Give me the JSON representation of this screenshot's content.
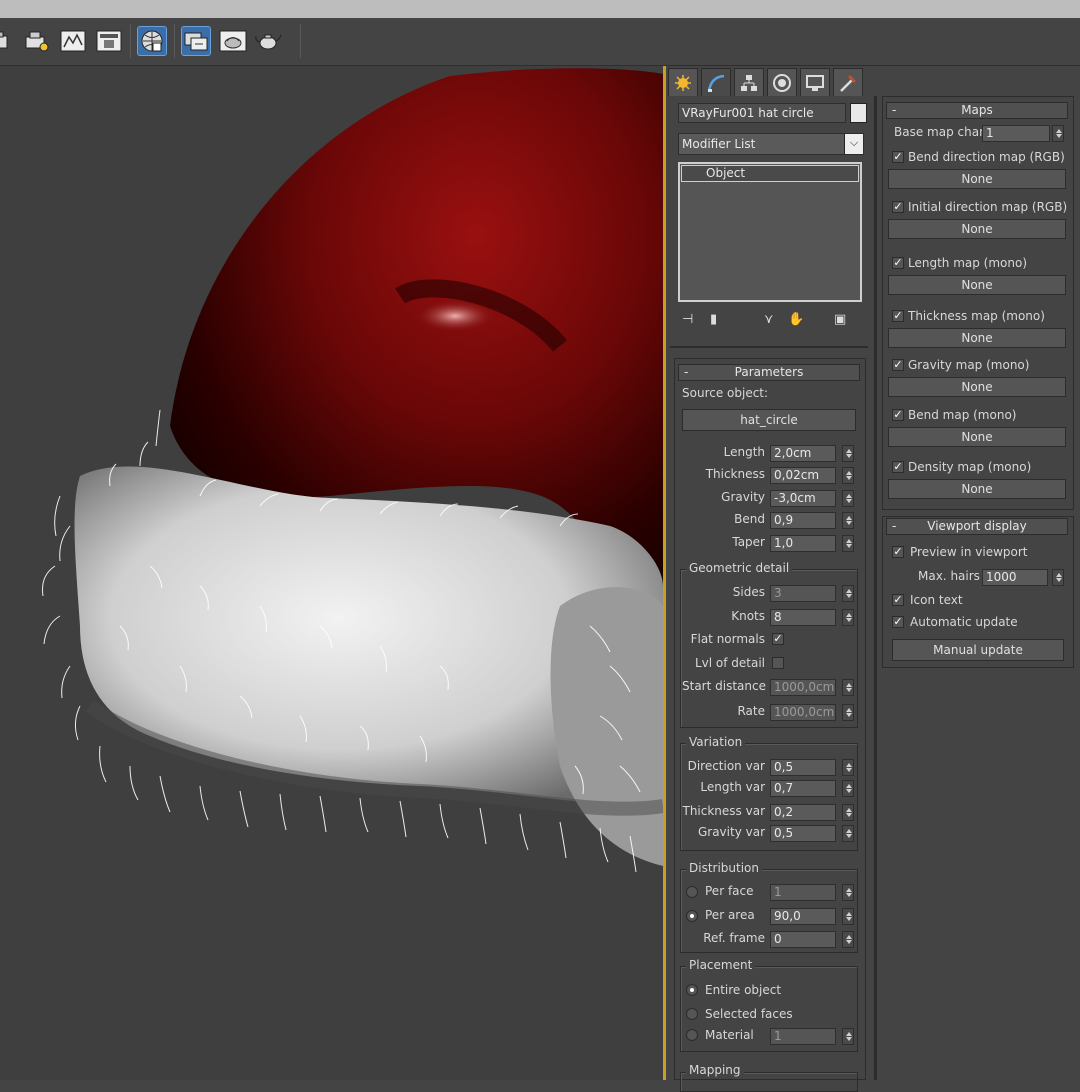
{
  "toolbar": {
    "icons": [
      "render-setup-icon",
      "render-frame-icon",
      "rendered-frame-window-icon",
      "render-to-texture-icon",
      "environment-icon",
      "material-editor-icon",
      "render-production-icon",
      "teapot-render-icon"
    ]
  },
  "command_panel": {
    "tabs": [
      "create-tab",
      "modify-tab",
      "hierarchy-tab",
      "motion-tab",
      "display-tab",
      "utilities-tab"
    ],
    "object_name": "VRayFur001 hat circle",
    "modifier_list": "Modifier List",
    "stack_item": "Object"
  },
  "parameters": {
    "header": "Parameters",
    "source_label": "Source object:",
    "source_button": "hat_circle",
    "length_label": "Length",
    "length": "2,0cm",
    "thickness_label": "Thickness",
    "thickness": "0,02cm",
    "gravity_label": "Gravity",
    "gravity": "-3,0cm",
    "bend_label": "Bend",
    "bend": "0,9",
    "taper_label": "Taper",
    "taper": "1,0",
    "geo_title": "Geometric detail",
    "sides_label": "Sides",
    "sides": "3",
    "knots_label": "Knots",
    "knots": "8",
    "flat_normals_label": "Flat normals",
    "lvl_label": "Lvl of detail",
    "start_label": "Start distance",
    "start": "1000,0cm",
    "rate_label": "Rate",
    "rate": "1000,0cm",
    "var_title": "Variation",
    "dir_var_label": "Direction var",
    "dir_var": "0,5",
    "len_var_label": "Length var",
    "len_var": "0,7",
    "thick_var_label": "Thickness var",
    "thick_var": "0,2",
    "grav_var_label": "Gravity var",
    "grav_var": "0,5",
    "dist_title": "Distribution",
    "per_face_label": "Per face",
    "per_face": "1",
    "per_area_label": "Per area",
    "per_area": "90,0",
    "ref_frame_label": "Ref. frame",
    "ref_frame": "0",
    "place_title": "Placement",
    "entire_label": "Entire object",
    "selected_label": "Selected faces",
    "material_label": "Material",
    "material": "1",
    "mapping_title": "Mapping"
  },
  "maps": {
    "header": "Maps",
    "base_label": "Base map chan",
    "base": "1",
    "items": [
      {
        "label": "Bend direction map (RGB)",
        "value": "None"
      },
      {
        "label": "Initial direction map (RGB)",
        "value": "None"
      },
      {
        "label": "Length map (mono)",
        "value": "None"
      },
      {
        "label": "Thickness map (mono)",
        "value": "None"
      },
      {
        "label": "Gravity map (mono)",
        "value": "None"
      },
      {
        "label": "Bend map (mono)",
        "value": "None"
      },
      {
        "label": "Density map (mono)",
        "value": "None"
      }
    ]
  },
  "viewport_display": {
    "header": "Viewport display",
    "preview_label": "Preview in viewport",
    "max_hairs_label": "Max. hairs",
    "max_hairs": "1000",
    "icon_text_label": "Icon text",
    "auto_update_label": "Automatic update",
    "manual_button": "Manual update"
  },
  "colors": {
    "accent": "#3a6ea8",
    "viewport_border": "#c8a020",
    "hat_red": "#7a0c0c"
  }
}
